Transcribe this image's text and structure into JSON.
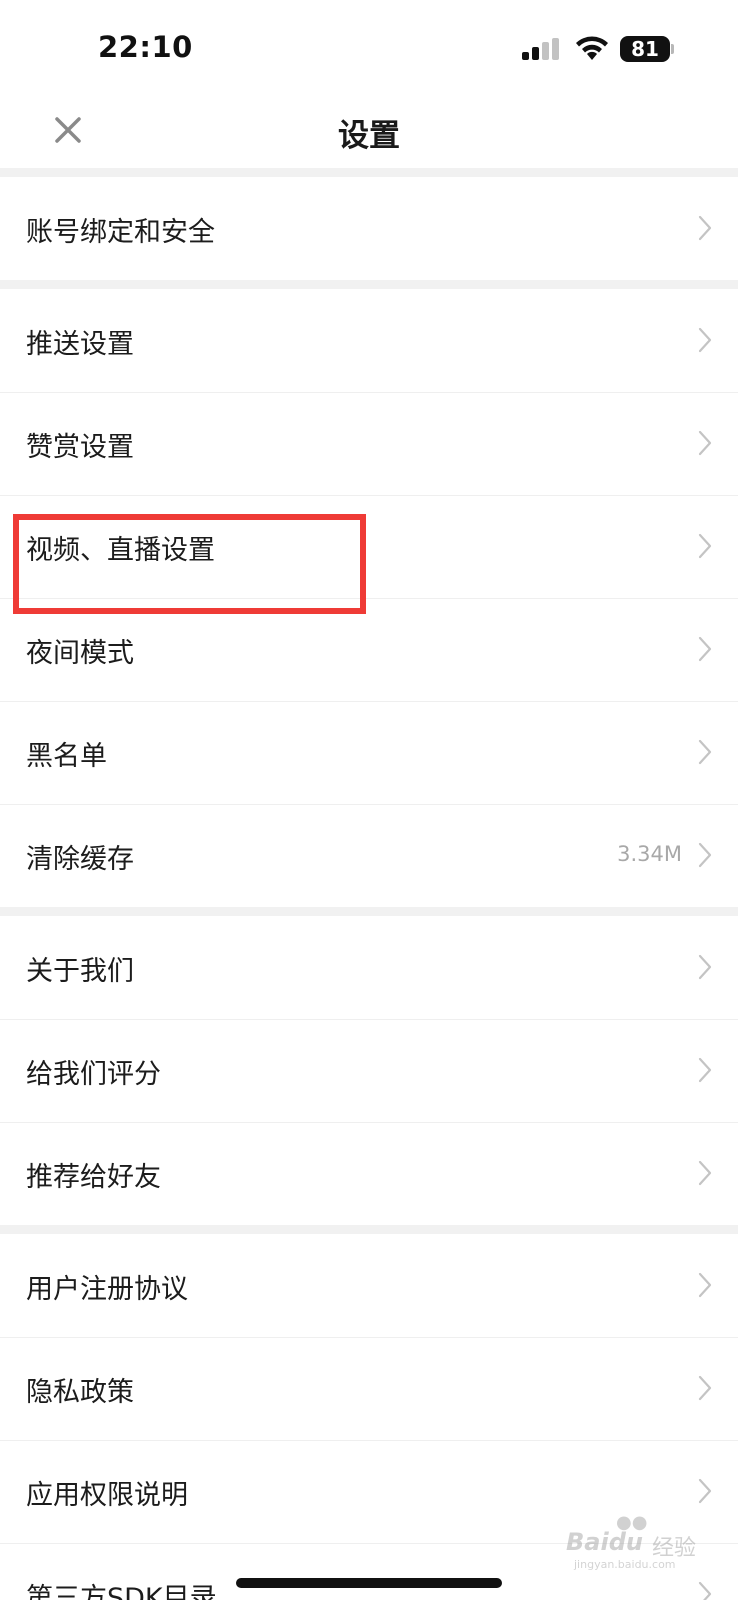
{
  "status": {
    "time": "22:10",
    "battery": "81",
    "icons": [
      "signal-icon",
      "wifi-icon",
      "battery-icon"
    ]
  },
  "nav": {
    "title": "设置",
    "close_icon": "close-icon"
  },
  "groups": [
    {
      "items": [
        {
          "label": "账号绑定和安全"
        }
      ]
    },
    {
      "items": [
        {
          "label": "推送设置"
        },
        {
          "label": "赞赏设置"
        },
        {
          "label": "视频、直播设置",
          "highlighted": true
        },
        {
          "label": "夜间模式"
        },
        {
          "label": "黑名单"
        },
        {
          "label": "清除缓存",
          "value": "3.34M"
        }
      ]
    },
    {
      "items": [
        {
          "label": "关于我们"
        },
        {
          "label": "给我们评分"
        },
        {
          "label": "推荐给好友"
        }
      ]
    },
    {
      "items": [
        {
          "label": "用户注册协议"
        },
        {
          "label": "隐私政策"
        },
        {
          "label": "应用权限说明"
        },
        {
          "label": "第三方SDK目录"
        }
      ]
    }
  ],
  "watermark": {
    "brand": "Baidu",
    "brand_cn": "经验",
    "domain": "jingyan.baidu.com"
  },
  "colors": {
    "highlight": "#ef3b36",
    "separator": "#f1f1f1",
    "chevron": "#c4c4c4"
  }
}
